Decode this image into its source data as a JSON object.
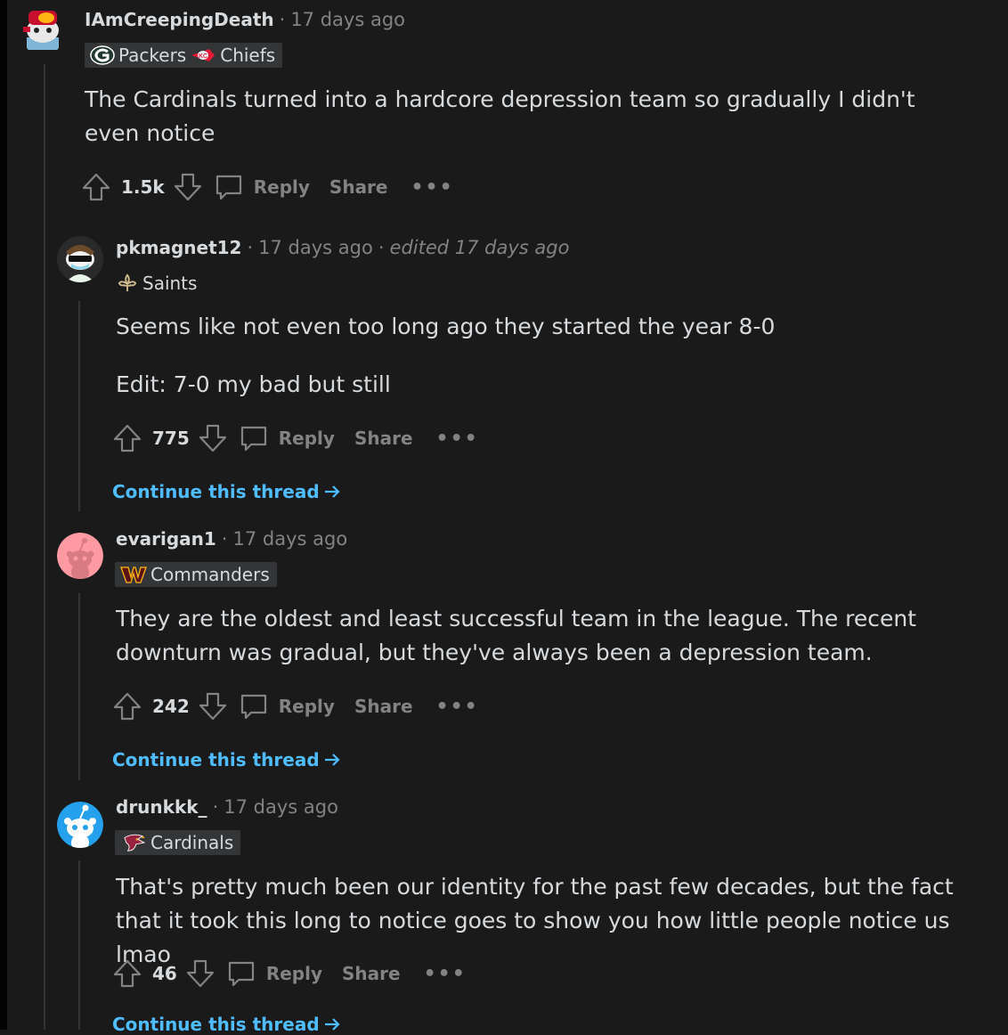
{
  "comments": [
    {
      "username": "IAmCreepingDeath",
      "time": "17 days ago",
      "flair": [
        {
          "icon": "packers-logo-icon",
          "label": "Packers"
        },
        {
          "icon": "chiefs-logo-icon",
          "label": "Chiefs"
        }
      ],
      "body": [
        "The Cardinals turned into a hardcore depression team so gradually I didn't even notice"
      ],
      "score": "1.5k",
      "reply_label": "Reply",
      "share_label": "Share",
      "more_label": "•••"
    },
    {
      "username": "pkmagnet12",
      "time": "17 days ago",
      "edited": "edited 17 days ago",
      "flair_label": "Saints",
      "body": [
        "Seems like not even too long ago they started the year 8-0",
        "Edit: 7-0 my bad but still"
      ],
      "score": "775",
      "reply_label": "Reply",
      "share_label": "Share",
      "more_label": "•••",
      "continue_label": "Continue this thread"
    },
    {
      "username": "evarigan1",
      "time": "17 days ago",
      "flair_label": "Commanders",
      "body": [
        "They are the oldest and least successful team in the league. The recent downturn was gradual, but they've always been a depression team."
      ],
      "score": "242",
      "reply_label": "Reply",
      "share_label": "Share",
      "more_label": "•••",
      "continue_label": "Continue this thread"
    },
    {
      "username": "drunkkk_",
      "time": "17 days ago",
      "flair_label": "Cardinals",
      "body": [
        "That's pretty much been our identity for the past few decades, but the fact that it took this long to notice goes to show you how little people notice us lmao"
      ],
      "score": "46",
      "reply_label": "Reply",
      "share_label": "Share",
      "more_label": "•••",
      "continue_label": "Continue this thread"
    }
  ],
  "separator": "·",
  "colors": {
    "background": "#1a1a1b",
    "text": "#d7dadc",
    "muted": "#818384",
    "link": "#4fbcff",
    "flair_bg": "#343536"
  }
}
